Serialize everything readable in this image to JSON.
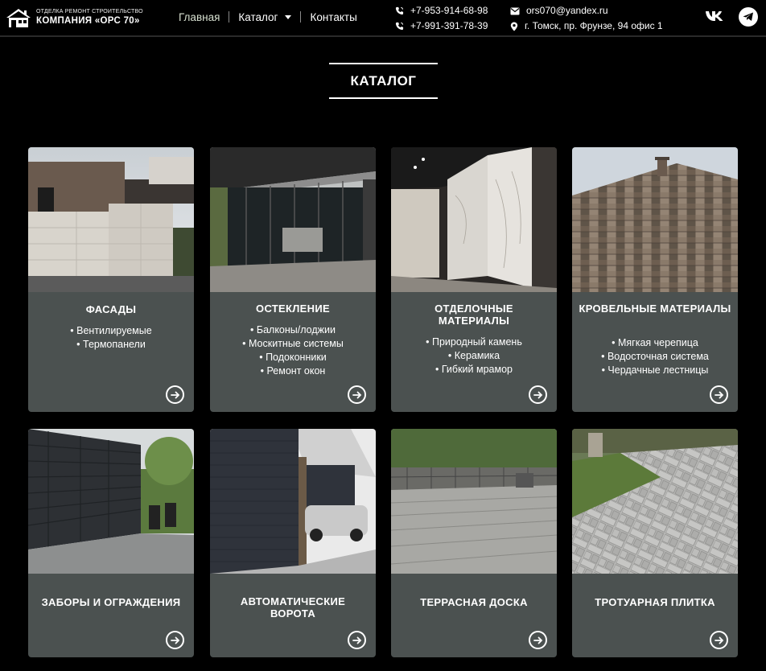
{
  "header": {
    "logo_sub": "ОТДЕЛКА РЕМОНТ СТРОИТЕЛЬСТВО",
    "logo_main": "КОМПАНИЯ «ОРС 70»",
    "nav": [
      {
        "label": "Главная"
      },
      {
        "label": "Каталог"
      },
      {
        "label": "Контакты"
      }
    ],
    "phones": [
      "+7-953-914-68-98",
      "+7-991-391-78-39"
    ],
    "email": "ors070@yandex.ru",
    "address": "г. Томск, пр. Фрунзе, 94 офис 1",
    "social_icons": [
      "vk-icon",
      "telegram-icon"
    ]
  },
  "page": {
    "title": "КАТАЛОГ"
  },
  "colors": {
    "background": "#000000",
    "card": "#4b5150",
    "text": "#ffffff"
  },
  "cards": [
    {
      "title": "ФАСАДЫ",
      "items": [
        "• Вентилируемые",
        "• Термопанели"
      ]
    },
    {
      "title": "ОСТЕКЛЕНИЕ",
      "items": [
        "• Балконы/лоджии",
        "• Москитные системы",
        "• Подоконники",
        "• Ремонт окон"
      ]
    },
    {
      "title": "ОТДЕЛОЧНЫЕ МАТЕРИАЛЫ",
      "items": [
        "• Природный камень",
        "• Керамика",
        "• Гибкий мрамор"
      ]
    },
    {
      "title": "КРОВЕЛЬНЫЕ МАТЕРИАЛЫ",
      "items": [
        "• Мягкая черепица",
        "• Водосточная система",
        "• Чердачные лестницы"
      ]
    },
    {
      "title": "ЗАБОРЫ И ОГРАЖДЕНИЯ",
      "items": []
    },
    {
      "title": "АВТОМАТИЧЕСКИЕ ВОРОТА",
      "items": []
    },
    {
      "title": "ТЕРРАСНАЯ ДОСКА",
      "items": []
    },
    {
      "title": "ТРОТУАРНАЯ ПЛИТКА",
      "items": []
    }
  ]
}
